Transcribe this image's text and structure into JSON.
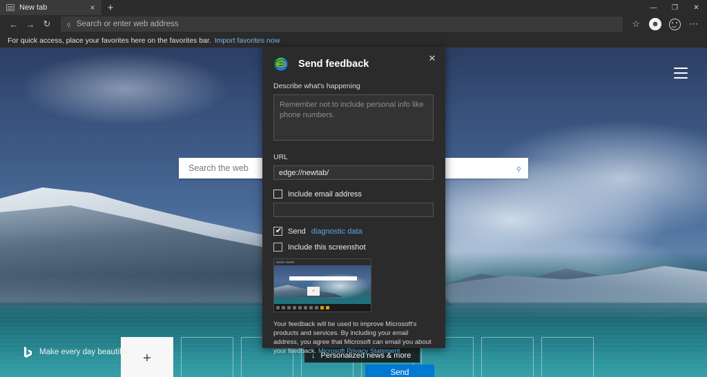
{
  "window": {
    "tab": {
      "title": "New tab",
      "close_label": "×",
      "favicon": "newtab-icon"
    },
    "new_tab_button": "+",
    "controls": {
      "minimize": "—",
      "maximize": "❐",
      "close": "✕"
    }
  },
  "navbar": {
    "back": "←",
    "forward": "→",
    "refresh": "↻",
    "address_placeholder": "Search or enter web address",
    "address_value": "",
    "search_icon": "⌕",
    "favorite_icon": "☆",
    "profile_icon": "person-icon",
    "feedback_icon": "smiley-icon",
    "settings_icon": "⋯"
  },
  "favorites_bar": {
    "message": "For quick access, place your favorites here on the favorites bar.",
    "link": "Import favorites now"
  },
  "newtab": {
    "search_placeholder": "Search the web",
    "search_value": "",
    "search_go_icon": "⌕",
    "menu_icon": "hamburger-icon",
    "tiles": [
      {
        "type": "add",
        "label": "+"
      },
      {
        "type": "empty",
        "label": ""
      },
      {
        "type": "empty",
        "label": ""
      },
      {
        "type": "empty",
        "label": ""
      },
      {
        "type": "empty",
        "label": ""
      },
      {
        "type": "empty",
        "label": ""
      },
      {
        "type": "empty",
        "label": ""
      },
      {
        "type": "empty",
        "label": ""
      }
    ],
    "bing_tagline": "Make every day beautiful",
    "news_pill": {
      "arrow": "↓",
      "label": "Personalized news & more"
    }
  },
  "dialog": {
    "title": "Send feedback",
    "close": "✕",
    "logo": "feedback-hub-icon",
    "describe_label": "Describe what's happening",
    "describe_placeholder": "Remember not to include personal info like phone numbers.",
    "describe_value": "",
    "url_label": "URL",
    "url_value": "edge://newtab/",
    "include_email_label": "Include email address",
    "include_email_checked": false,
    "email_value": "",
    "email_placeholder": "",
    "send_diagnostic_label": "Send",
    "send_diagnostic_link": "diagnostic data",
    "send_diagnostic_checked": true,
    "include_screenshot_label": "Include this screenshot",
    "include_screenshot_checked": false,
    "screenshot_alt": "screenshot-thumbnail",
    "footer_text": "Your feedback will be used to improve Microsoft's products and services. By including your email address, you agree that Microsoft can email you about your feedback. ",
    "footer_link": "Microsoft Privacy Statement",
    "send_button": "Send"
  },
  "colors": {
    "accent": "#0078d4",
    "link": "#59a6e8",
    "chrome_bg": "#2b2b2b",
    "dialog_bg": "#2b2b2b",
    "field_bg": "#333333"
  }
}
